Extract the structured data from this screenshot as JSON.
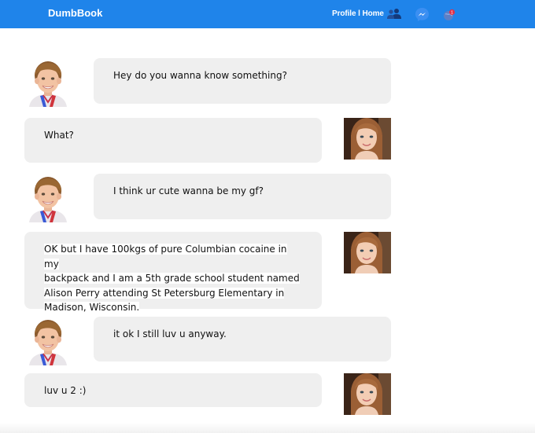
{
  "app": {
    "brand": "DumbBook"
  },
  "nav": {
    "links": "Profile l Home",
    "friends_icon": "friends-icon",
    "messenger_icon": "messenger-icon",
    "notification_icon": "globe-notification-icon",
    "notification_badge": "1"
  },
  "colors": {
    "topbar": "#1f84ea",
    "bubble": "#efefef",
    "messenger_blue": "#3b8ff2",
    "badge_red": "#e0334a"
  },
  "messages": [
    {
      "sender": "boy",
      "text": "Hey do you wanna know something?"
    },
    {
      "sender": "girl",
      "text": "What?"
    },
    {
      "sender": "boy",
      "text": "I think ur cute wanna be my gf?"
    },
    {
      "sender": "girl",
      "lines": [
        "OK but I have 100kgs of pure Columbian cocaine in my",
        "backpack and I am a 5th grade school student named",
        "Alison Perry attending St Petersburg Elementary in",
        "Madison, Wisconsin."
      ]
    },
    {
      "sender": "boy",
      "text": "it ok I still luv u anyway."
    },
    {
      "sender": "girl",
      "text": "luv u 2 :)"
    }
  ]
}
